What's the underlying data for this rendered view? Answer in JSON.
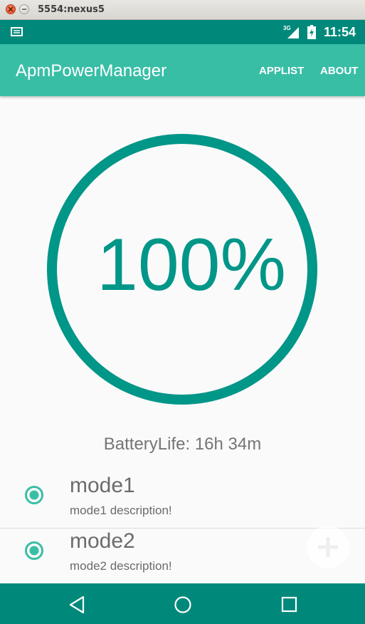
{
  "window": {
    "title": "5554:nexus5"
  },
  "status_bar": {
    "network": "3G",
    "time": "11:54",
    "icons": [
      "message-icon",
      "signal-icon",
      "battery-charging-icon"
    ]
  },
  "app_bar": {
    "title": "ApmPowerManager",
    "actions": [
      "APPLIST",
      "ABOUT"
    ]
  },
  "gauge": {
    "percent_text": "100%",
    "progress": 1.0,
    "color": "#009688"
  },
  "battery_life": "BatteryLife: 16h 34m",
  "modes": [
    {
      "name": "mode1",
      "description": "mode1 description!",
      "selected": true
    },
    {
      "name": "mode2",
      "description": "mode2 description!",
      "selected": true
    }
  ],
  "fab": {
    "icon": "plus-icon"
  },
  "nav_bar": {
    "icons": [
      "back-icon",
      "home-icon",
      "recent-apps-icon"
    ]
  },
  "colors": {
    "status_bar": "#00897b",
    "app_bar": "#39bea6",
    "accent": "#009688",
    "radio": "#39bea6"
  }
}
